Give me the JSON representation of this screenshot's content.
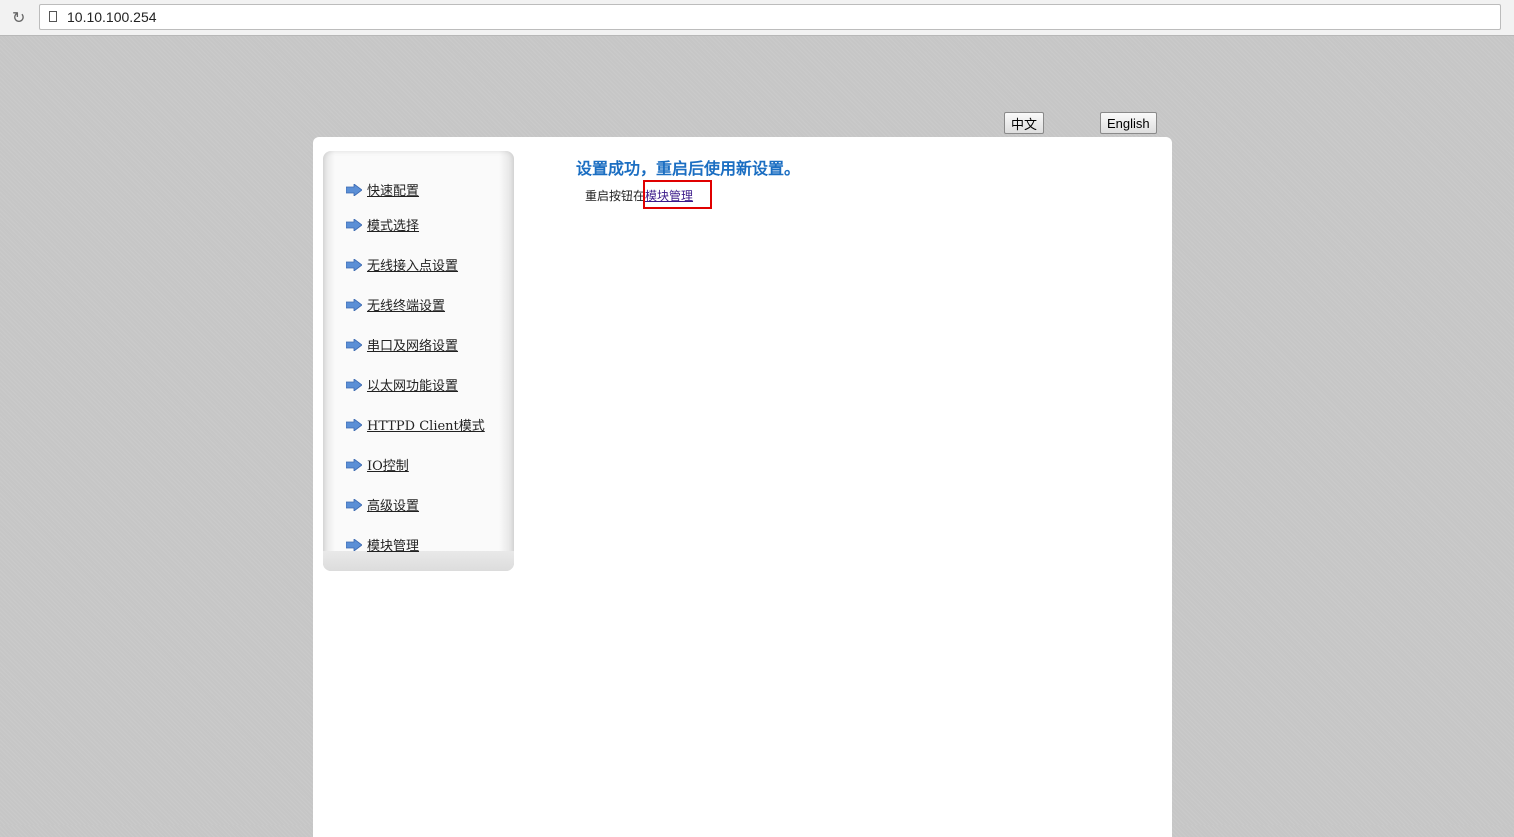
{
  "browser": {
    "url": "10.10.100.254"
  },
  "lang": {
    "zh": "中文",
    "en": "English"
  },
  "sidebar": {
    "items": [
      {
        "label": "快速配置"
      },
      {
        "label": "模式选择"
      },
      {
        "label": "无线接入点设置"
      },
      {
        "label": "无线终端设置"
      },
      {
        "label": "串口及网络设置"
      },
      {
        "label": "以太网功能设置"
      },
      {
        "label": "HTTPD Client模式"
      },
      {
        "label": "IO控制"
      },
      {
        "label": "高级设置"
      },
      {
        "label": "模块管理"
      }
    ]
  },
  "main": {
    "title": "设置成功，重启后使用新设置。",
    "hint_prefix": "重启按钮在",
    "hint_link": "模块管理"
  }
}
